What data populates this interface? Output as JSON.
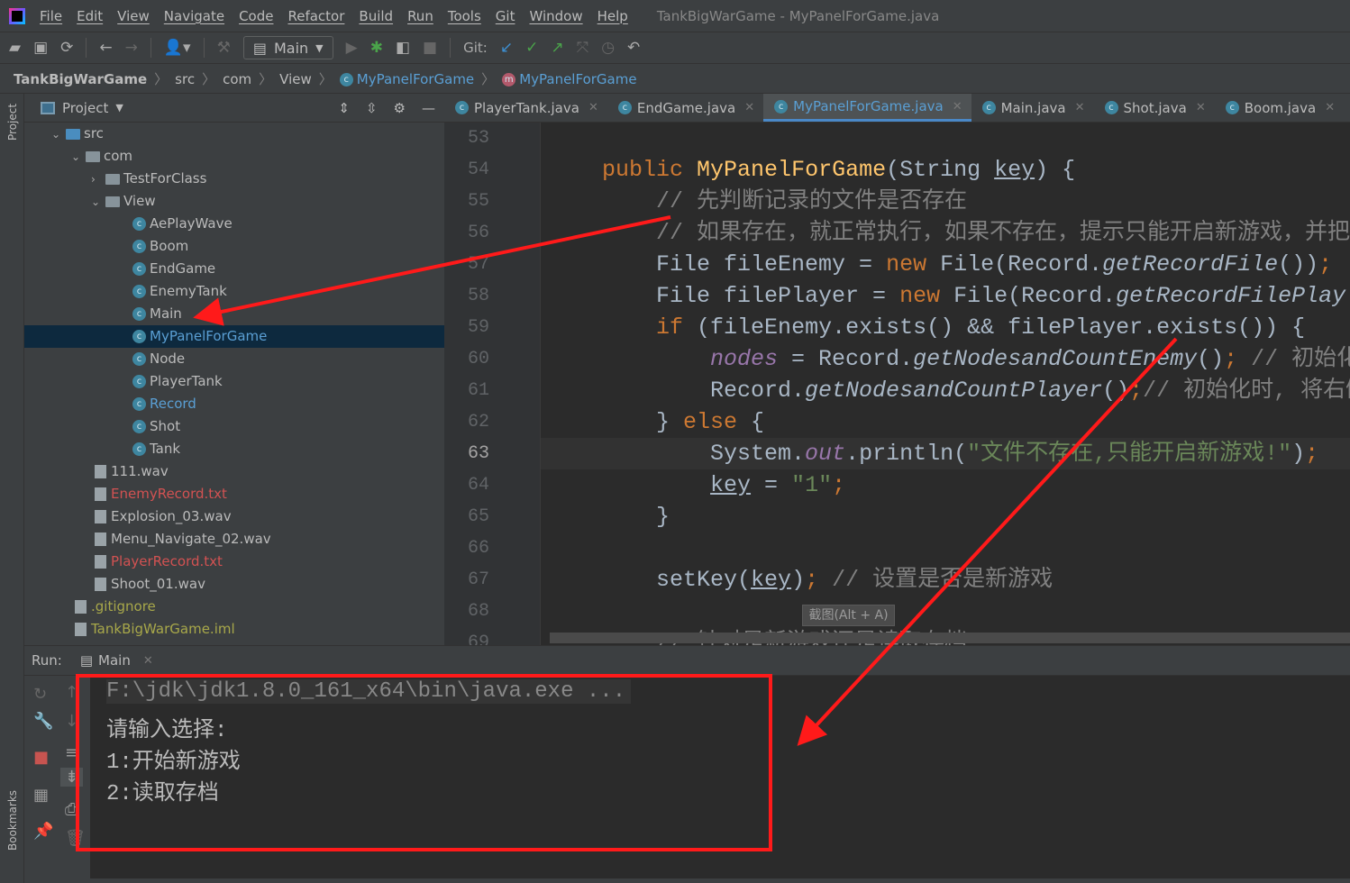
{
  "window_title": "TankBigWarGame - MyPanelForGame.java",
  "menu": [
    "File",
    "Edit",
    "View",
    "Navigate",
    "Code",
    "Refactor",
    "Build",
    "Run",
    "Tools",
    "Git",
    "Window",
    "Help"
  ],
  "toolbar": {
    "run_config": "Main",
    "git_label": "Git:"
  },
  "breadcrumb": [
    "TankBigWarGame",
    "src",
    "com",
    "View",
    "MyPanelForGame",
    "MyPanelForGame"
  ],
  "left_strip": {
    "project": "Project",
    "bookmarks": "Bookmarks"
  },
  "project_panel": {
    "title": "Project"
  },
  "tree": [
    {
      "label": "src",
      "kind": "srcfolder",
      "depth": 0,
      "arrow": "down"
    },
    {
      "label": "com",
      "kind": "folder",
      "depth": 1,
      "arrow": "down"
    },
    {
      "label": "TestForClass",
      "kind": "folder",
      "depth": 2,
      "arrow": "right"
    },
    {
      "label": "View",
      "kind": "folder",
      "depth": 2,
      "arrow": "down"
    },
    {
      "label": "AePlayWave",
      "kind": "class",
      "depth": 3
    },
    {
      "label": "Boom",
      "kind": "class",
      "depth": 3
    },
    {
      "label": "EndGame",
      "kind": "class",
      "depth": 3
    },
    {
      "label": "EnemyTank",
      "kind": "class",
      "depth": 3
    },
    {
      "label": "Main",
      "kind": "class",
      "depth": 3
    },
    {
      "label": "MyPanelForGame",
      "kind": "class",
      "depth": 3,
      "selected": true,
      "color": "#5a9fd4"
    },
    {
      "label": "Node",
      "kind": "class",
      "depth": 3
    },
    {
      "label": "PlayerTank",
      "kind": "class",
      "depth": 3
    },
    {
      "label": "Record",
      "kind": "class",
      "depth": 3,
      "color": "#5a9fd4"
    },
    {
      "label": "Shot",
      "kind": "class",
      "depth": 3
    },
    {
      "label": "Tank",
      "kind": "class",
      "depth": 3
    },
    {
      "label": "111.wav",
      "kind": "file",
      "depth": 1
    },
    {
      "label": "EnemyRecord.txt",
      "kind": "file",
      "depth": 1,
      "color": "#d25252"
    },
    {
      "label": "Explosion_03.wav",
      "kind": "file",
      "depth": 1
    },
    {
      "label": "Menu_Navigate_02.wav",
      "kind": "file",
      "depth": 1
    },
    {
      "label": "PlayerRecord.txt",
      "kind": "file",
      "depth": 1,
      "color": "#d25252"
    },
    {
      "label": "Shoot_01.wav",
      "kind": "file",
      "depth": 1
    },
    {
      "label": ".gitignore",
      "kind": "file",
      "depth": 0,
      "color": "#a8a84a"
    },
    {
      "label": "TankBigWarGame.iml",
      "kind": "file",
      "depth": 0,
      "color": "#a8a84a"
    }
  ],
  "tabs": [
    {
      "label": "PlayerTank.java"
    },
    {
      "label": "EndGame.java"
    },
    {
      "label": "MyPanelForGame.java",
      "active": true
    },
    {
      "label": "Main.java"
    },
    {
      "label": "Shot.java"
    },
    {
      "label": "Boom.java"
    },
    {
      "label": "R"
    }
  ],
  "editor": {
    "current_line": 63,
    "lines": [
      {
        "n": 53,
        "tokens": []
      },
      {
        "n": 54,
        "tokens": [
          [
            "    ",
            ""
          ],
          [
            "public ",
            "kw"
          ],
          [
            "MyPanelForGame",
            "fn"
          ],
          [
            "(String ",
            ""
          ],
          [
            "key",
            "ul"
          ],
          [
            ") {",
            ""
          ]
        ]
      },
      {
        "n": 55,
        "tokens": [
          [
            "        ",
            ""
          ],
          [
            "// 先判断记录的文件是否存在",
            "cm"
          ]
        ]
      },
      {
        "n": 56,
        "tokens": [
          [
            "        ",
            ""
          ],
          [
            "// 如果存在，就正常执行，如果不存在，提示只能开启新游戏，并把",
            "cm"
          ]
        ]
      },
      {
        "n": 57,
        "tokens": [
          [
            "        File fileEnemy = ",
            ""
          ],
          [
            "new ",
            "kw"
          ],
          [
            "File(Record.",
            ""
          ],
          [
            "getRecordFile",
            "it"
          ],
          [
            "())",
            ""
          ],
          [
            ";",
            "kw"
          ]
        ]
      },
      {
        "n": 58,
        "tokens": [
          [
            "        File filePlayer = ",
            ""
          ],
          [
            "new ",
            "kw"
          ],
          [
            "File(Record.",
            ""
          ],
          [
            "getRecordFilePlay",
            "it"
          ]
        ]
      },
      {
        "n": 59,
        "tokens": [
          [
            "        ",
            ""
          ],
          [
            "if ",
            "kw"
          ],
          [
            "(fileEnemy.exists() && filePlayer.exists()) {",
            ""
          ]
        ]
      },
      {
        "n": 60,
        "tokens": [
          [
            "            ",
            ""
          ],
          [
            "nodes",
            "fld"
          ],
          [
            " = Record.",
            ""
          ],
          [
            "getNodesandCountEnemy",
            "it"
          ],
          [
            "()",
            ""
          ],
          [
            "; ",
            "kw"
          ],
          [
            "// 初始化",
            "cm"
          ]
        ]
      },
      {
        "n": 61,
        "tokens": [
          [
            "            Record.",
            ""
          ],
          [
            "getNodesandCountPlayer",
            "it"
          ],
          [
            "()",
            ""
          ],
          [
            ";",
            "kw"
          ],
          [
            "// 初始化时, 将右侧",
            "cm"
          ]
        ]
      },
      {
        "n": 62,
        "tokens": [
          [
            "        } ",
            ""
          ],
          [
            "else ",
            "kw"
          ],
          [
            "{",
            ""
          ]
        ]
      },
      {
        "n": 63,
        "tokens": [
          [
            "            System.",
            ""
          ],
          [
            "out",
            "fld"
          ],
          [
            ".println(",
            ""
          ],
          [
            "\"文件不存在,只能开启新游戏!\"",
            "st"
          ],
          [
            ")",
            ""
          ],
          [
            ";",
            "kw"
          ]
        ]
      },
      {
        "n": 64,
        "tokens": [
          [
            "            ",
            ""
          ],
          [
            "key",
            "ul"
          ],
          [
            " = ",
            ""
          ],
          [
            "\"1\"",
            "st"
          ],
          [
            ";",
            "kw"
          ]
        ]
      },
      {
        "n": 65,
        "tokens": [
          [
            "        }",
            ""
          ]
        ]
      },
      {
        "n": 66,
        "tokens": []
      },
      {
        "n": 67,
        "tokens": [
          [
            "        setKey(",
            ""
          ],
          [
            "key",
            "ul"
          ],
          [
            ")",
            ""
          ],
          [
            "; ",
            "kw"
          ],
          [
            "// 设置是否是新游戏",
            "cm"
          ]
        ]
      },
      {
        "n": 68,
        "tokens": []
      },
      {
        "n": 69,
        "tokens": [
          [
            "        ",
            ""
          ],
          [
            "// 针对是新游戏还是读取存档",
            "cm"
          ]
        ]
      }
    ],
    "tooltip": "截图(Alt + A)"
  },
  "run": {
    "label": "Run:",
    "tab": "Main",
    "console": [
      "F:\\jdk\\jdk1.8.0_161_x64\\bin\\java.exe ...",
      "请输入选择:",
      "1:开始新游戏",
      "2:读取存档"
    ]
  },
  "colors": {
    "annotation": "#ff1a1a",
    "selection": "#0d293e",
    "accent": "#4a88c7"
  }
}
